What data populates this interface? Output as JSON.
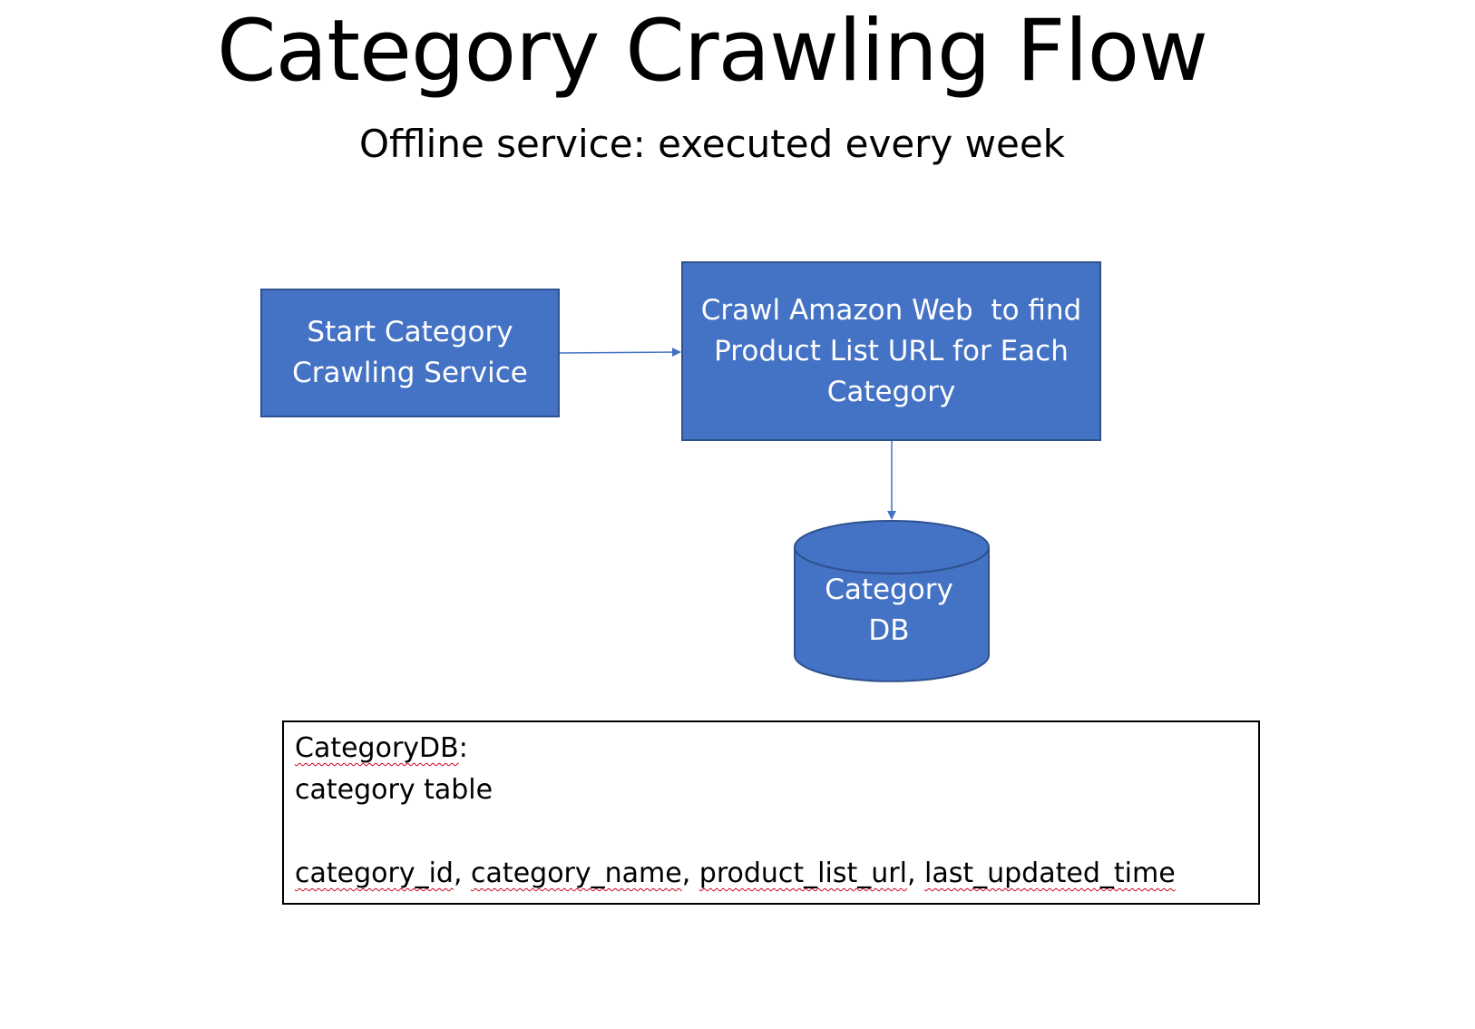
{
  "title": "Category Crawling Flow",
  "subtitle": "Offline service: executed every week",
  "nodes": {
    "start": {
      "lines": [
        "Start Category",
        "Crawling Service"
      ]
    },
    "crawl": {
      "lines": [
        "Crawl Amazon Web  to find",
        "Product List URL for Each",
        "Category"
      ]
    },
    "db": {
      "lines": [
        "Category",
        "DB"
      ]
    }
  },
  "note": {
    "heading_word": "CategoryDB",
    "heading_suffix": ":",
    "line2": "category table",
    "line3": "",
    "fields": {
      "f1": "category_id",
      "sep1": ", ",
      "f2": "category_name",
      "sep2": ", ",
      "f3": "product_list_url",
      "sep3": ", ",
      "f4": "last_updated_time"
    }
  },
  "colors": {
    "node_fill": "#4472c4",
    "node_border": "#2f528f",
    "arrow": "#4472c4",
    "spellcheck": "#d0021b"
  }
}
